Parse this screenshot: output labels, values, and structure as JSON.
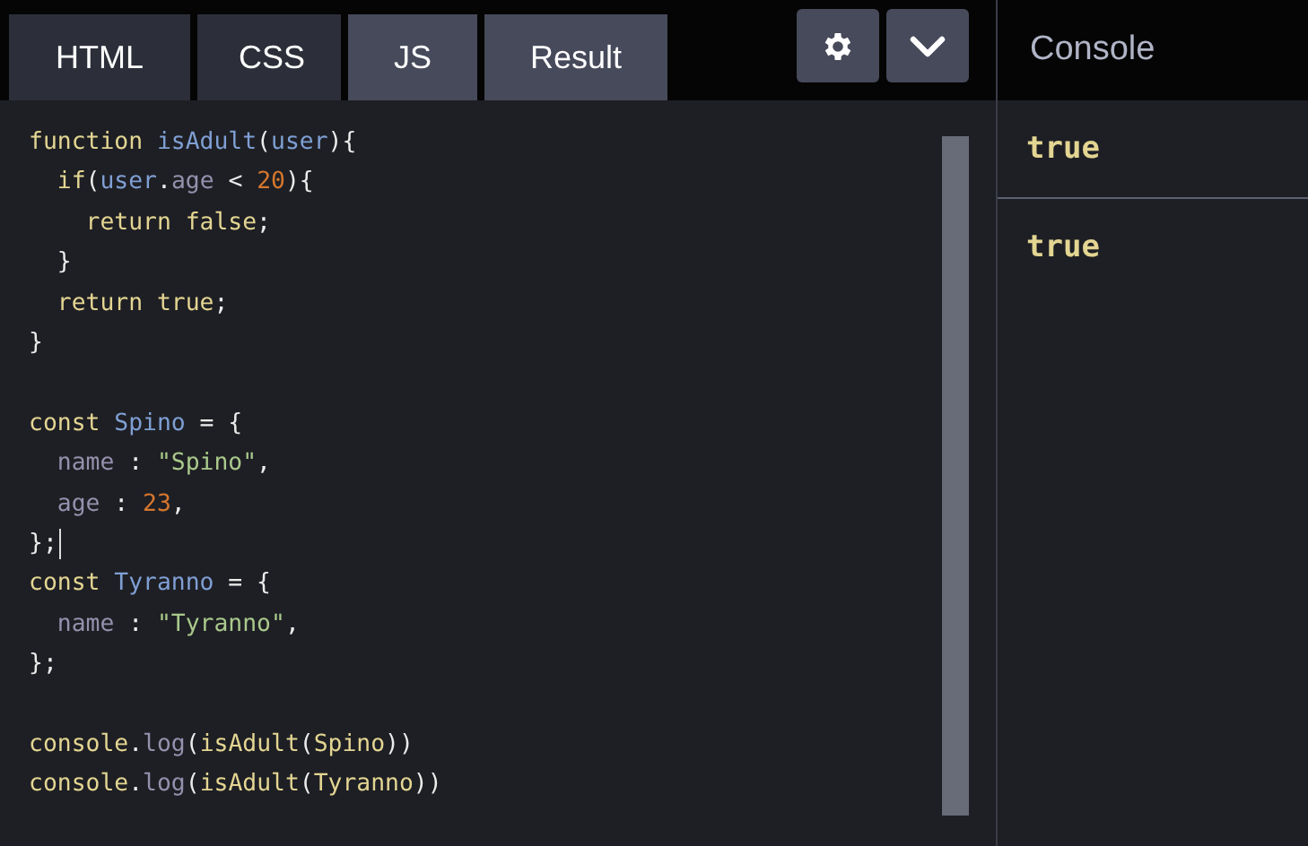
{
  "tabs": [
    {
      "label": "HTML",
      "selected": false
    },
    {
      "label": "CSS",
      "selected": false
    },
    {
      "label": "JS",
      "selected": true
    },
    {
      "label": "Result",
      "selected": true
    }
  ],
  "console": {
    "title": "Console",
    "entries": [
      "true",
      "true"
    ]
  },
  "editor": {
    "blocks": [
      {
        "lines": [
          {
            "cursor": false,
            "tokens": [
              {
                "t": "function ",
                "kind": "keyword"
              },
              {
                "t": "isAdult",
                "kind": "name"
              },
              {
                "t": "(",
                "kind": "punct"
              },
              {
                "t": "user",
                "kind": "name"
              },
              {
                "t": "){",
                "kind": "punct"
              }
            ]
          },
          {
            "cursor": false,
            "tokens": [
              {
                "t": "  if",
                "kind": "keyword"
              },
              {
                "t": "(",
                "kind": "punct"
              },
              {
                "t": "user",
                "kind": "name"
              },
              {
                "t": ".",
                "kind": "punct"
              },
              {
                "t": "age",
                "kind": "prop"
              },
              {
                "t": " < ",
                "kind": "punct"
              },
              {
                "t": "20",
                "kind": "number"
              },
              {
                "t": "){",
                "kind": "punct"
              }
            ]
          },
          {
            "cursor": false,
            "tokens": [
              {
                "t": "    return false",
                "kind": "keyword"
              },
              {
                "t": ";",
                "kind": "punct"
              }
            ]
          },
          {
            "cursor": false,
            "tokens": [
              {
                "t": "  }",
                "kind": "punct"
              }
            ]
          },
          {
            "cursor": false,
            "tokens": [
              {
                "t": "  return true",
                "kind": "keyword"
              },
              {
                "t": ";",
                "kind": "punct"
              }
            ]
          },
          {
            "cursor": false,
            "tokens": [
              {
                "t": "}",
                "kind": "punct"
              }
            ]
          }
        ]
      },
      {
        "lines": [
          {
            "cursor": false,
            "tokens": [
              {
                "t": "const ",
                "kind": "keyword"
              },
              {
                "t": "Spino",
                "kind": "name"
              },
              {
                "t": " = {",
                "kind": "punct"
              }
            ]
          },
          {
            "cursor": false,
            "tokens": [
              {
                "t": "  name",
                "kind": "prop"
              },
              {
                "t": " : ",
                "kind": "punct"
              },
              {
                "t": "\"Spino\"",
                "kind": "string"
              },
              {
                "t": ",",
                "kind": "punct"
              }
            ]
          },
          {
            "cursor": false,
            "tokens": [
              {
                "t": "  age",
                "kind": "prop"
              },
              {
                "t": " : ",
                "kind": "punct"
              },
              {
                "t": "23",
                "kind": "number"
              },
              {
                "t": ",",
                "kind": "punct"
              }
            ]
          },
          {
            "cursor": true,
            "tokens": [
              {
                "t": "};",
                "kind": "punct"
              }
            ]
          },
          {
            "cursor": false,
            "tokens": [
              {
                "t": "const ",
                "kind": "keyword"
              },
              {
                "t": "Tyranno",
                "kind": "name"
              },
              {
                "t": " = {",
                "kind": "punct"
              }
            ]
          },
          {
            "cursor": false,
            "tokens": [
              {
                "t": "  name",
                "kind": "prop"
              },
              {
                "t": " : ",
                "kind": "punct"
              },
              {
                "t": "\"Tyranno\"",
                "kind": "string"
              },
              {
                "t": ",",
                "kind": "punct"
              }
            ]
          },
          {
            "cursor": false,
            "tokens": [
              {
                "t": "};",
                "kind": "punct"
              }
            ]
          }
        ]
      },
      {
        "lines": [
          {
            "cursor": false,
            "tokens": [
              {
                "t": "console",
                "kind": "keyword"
              },
              {
                "t": ".",
                "kind": "punct"
              },
              {
                "t": "log",
                "kind": "prop"
              },
              {
                "t": "(",
                "kind": "punct"
              },
              {
                "t": "isAdult",
                "kind": "keyword"
              },
              {
                "t": "(",
                "kind": "punct"
              },
              {
                "t": "Spino",
                "kind": "keyword"
              },
              {
                "t": "))",
                "kind": "punct"
              }
            ]
          },
          {
            "cursor": false,
            "tokens": [
              {
                "t": "console",
                "kind": "keyword"
              },
              {
                "t": ".",
                "kind": "punct"
              },
              {
                "t": "log",
                "kind": "prop"
              },
              {
                "t": "(",
                "kind": "punct"
              },
              {
                "t": "isAdult",
                "kind": "keyword"
              },
              {
                "t": "(",
                "kind": "punct"
              },
              {
                "t": "Tyranno",
                "kind": "keyword"
              },
              {
                "t": "))",
                "kind": "punct"
              }
            ]
          }
        ]
      }
    ]
  }
}
